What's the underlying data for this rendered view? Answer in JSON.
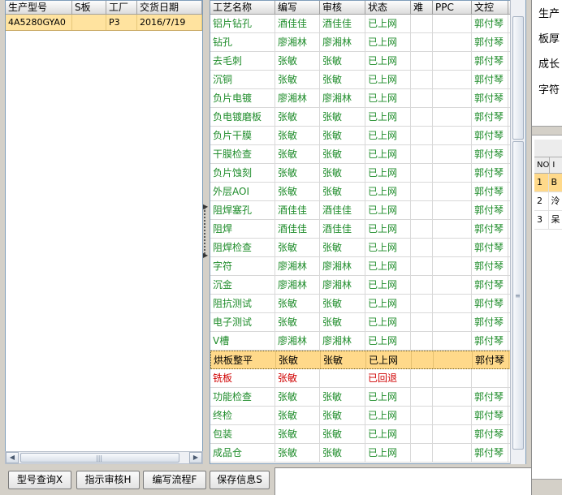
{
  "order_list": {
    "headers": [
      "生产型号",
      "S板",
      "工厂",
      "交货日期"
    ],
    "rows": [
      {
        "model": "4A5280GYA0",
        "s_board": "",
        "factory": "P3",
        "delivery_date": "2016/7/19"
      }
    ]
  },
  "process_grid": {
    "headers": [
      "工艺名称",
      "编写",
      "审核",
      "状态",
      "难",
      "PPC",
      "文控"
    ],
    "rows": [
      {
        "name": "铝片钻孔",
        "writer": "酒佳佳",
        "reviewer": "酒佳佳",
        "status": "已上网",
        "difficulty": "",
        "ppc": "",
        "doc_control": "郭付琴"
      },
      {
        "name": "钻孔",
        "writer": "廖湘林",
        "reviewer": "廖湘林",
        "status": "已上网",
        "difficulty": "",
        "ppc": "",
        "doc_control": "郭付琴"
      },
      {
        "name": "去毛刺",
        "writer": "张敏",
        "reviewer": "张敏",
        "status": "已上网",
        "difficulty": "",
        "ppc": "",
        "doc_control": "郭付琴"
      },
      {
        "name": "沉铜",
        "writer": "张敏",
        "reviewer": "张敏",
        "status": "已上网",
        "difficulty": "",
        "ppc": "",
        "doc_control": "郭付琴"
      },
      {
        "name": "负片电镀",
        "writer": "廖湘林",
        "reviewer": "廖湘林",
        "status": "已上网",
        "difficulty": "",
        "ppc": "",
        "doc_control": "郭付琴"
      },
      {
        "name": "负电镀磨板",
        "writer": "张敏",
        "reviewer": "张敏",
        "status": "已上网",
        "difficulty": "",
        "ppc": "",
        "doc_control": "郭付琴"
      },
      {
        "name": "负片干膜",
        "writer": "张敏",
        "reviewer": "张敏",
        "status": "已上网",
        "difficulty": "",
        "ppc": "",
        "doc_control": "郭付琴"
      },
      {
        "name": "干膜检查",
        "writer": "张敏",
        "reviewer": "张敏",
        "status": "已上网",
        "difficulty": "",
        "ppc": "",
        "doc_control": "郭付琴"
      },
      {
        "name": "负片蚀刻",
        "writer": "张敏",
        "reviewer": "张敏",
        "status": "已上网",
        "difficulty": "",
        "ppc": "",
        "doc_control": "郭付琴"
      },
      {
        "name": "外层AOI",
        "writer": "张敏",
        "reviewer": "张敏",
        "status": "已上网",
        "difficulty": "",
        "ppc": "",
        "doc_control": "郭付琴"
      },
      {
        "name": "阻焊塞孔",
        "writer": "酒佳佳",
        "reviewer": "酒佳佳",
        "status": "已上网",
        "difficulty": "",
        "ppc": "",
        "doc_control": "郭付琴"
      },
      {
        "name": "阻焊",
        "writer": "酒佳佳",
        "reviewer": "酒佳佳",
        "status": "已上网",
        "difficulty": "",
        "ppc": "",
        "doc_control": "郭付琴"
      },
      {
        "name": "阻焊检查",
        "writer": "张敏",
        "reviewer": "张敏",
        "status": "已上网",
        "difficulty": "",
        "ppc": "",
        "doc_control": "郭付琴"
      },
      {
        "name": "字符",
        "writer": "廖湘林",
        "reviewer": "廖湘林",
        "status": "已上网",
        "difficulty": "",
        "ppc": "",
        "doc_control": "郭付琴"
      },
      {
        "name": "沉金",
        "writer": "廖湘林",
        "reviewer": "廖湘林",
        "status": "已上网",
        "difficulty": "",
        "ppc": "",
        "doc_control": "郭付琴"
      },
      {
        "name": "阻抗测试",
        "writer": "张敏",
        "reviewer": "张敏",
        "status": "已上网",
        "difficulty": "",
        "ppc": "",
        "doc_control": "郭付琴"
      },
      {
        "name": "电子测试",
        "writer": "张敏",
        "reviewer": "张敏",
        "status": "已上网",
        "difficulty": "",
        "ppc": "",
        "doc_control": "郭付琴"
      },
      {
        "name": "V槽",
        "writer": "廖湘林",
        "reviewer": "廖湘林",
        "status": "已上网",
        "difficulty": "",
        "ppc": "",
        "doc_control": "郭付琴"
      },
      {
        "name": "烘板整平",
        "writer": "张敏",
        "reviewer": "张敏",
        "status": "已上网",
        "difficulty": "",
        "ppc": "",
        "doc_control": "郭付琴"
      },
      {
        "name": "铣板",
        "writer": "张敏",
        "reviewer": "",
        "status": "已回退",
        "difficulty": "",
        "ppc": "",
        "doc_control": ""
      },
      {
        "name": "功能检查",
        "writer": "张敏",
        "reviewer": "张敏",
        "status": "已上网",
        "difficulty": "",
        "ppc": "",
        "doc_control": "郭付琴"
      },
      {
        "name": "终检",
        "writer": "张敏",
        "reviewer": "张敏",
        "status": "已上网",
        "difficulty": "",
        "ppc": "",
        "doc_control": "郭付琴"
      },
      {
        "name": "包装",
        "writer": "张敏",
        "reviewer": "张敏",
        "status": "已上网",
        "difficulty": "",
        "ppc": "",
        "doc_control": "郭付琴"
      },
      {
        "name": "成品仓",
        "writer": "张敏",
        "reviewer": "张敏",
        "status": "已上网",
        "difficulty": "",
        "ppc": "",
        "doc_control": "郭付琴"
      }
    ]
  },
  "detail_panel": {
    "labels": [
      "生产",
      "板厚",
      "成长",
      "字符"
    ],
    "grid_header": "NO",
    "grid_col2": "I",
    "grid_rows": [
      {
        "no": "1",
        "text": "B"
      },
      {
        "no": "2",
        "text": "泠"
      },
      {
        "no": "3",
        "text": "呆"
      }
    ]
  },
  "toolbar": {
    "query_model": "型号查询X",
    "review_instructions": "指示审核H",
    "write_flow": "编写流程F",
    "save_info": "保存信息S"
  },
  "colors": {
    "approved_text": "#1e8c2a",
    "rejected_text": "#d00000",
    "selected_row": "#ffd98a"
  }
}
